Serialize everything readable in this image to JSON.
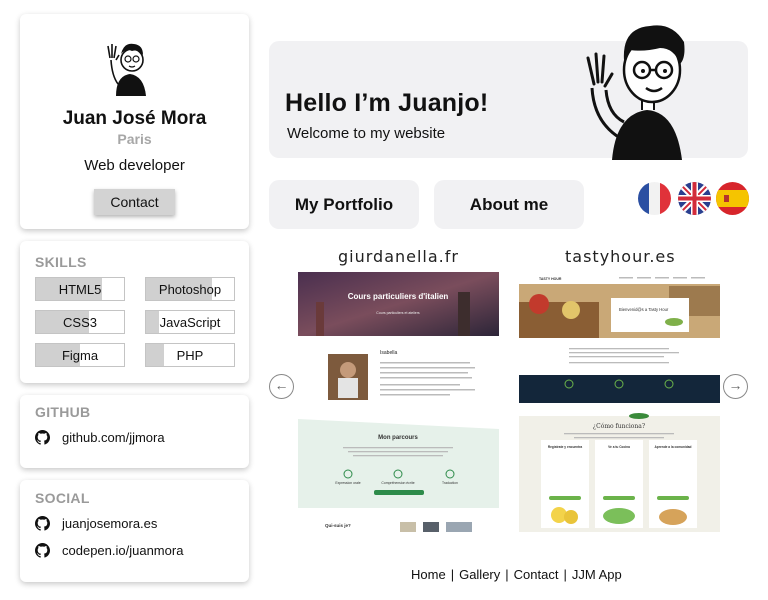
{
  "profile": {
    "name": "Juan José Mora",
    "city": "Paris",
    "role": "Web developer",
    "contact_label": "Contact"
  },
  "skills": {
    "title": "SKILLS",
    "items": [
      {
        "label": "HTML5",
        "level": 0.75
      },
      {
        "label": "Photoshop",
        "level": 0.75
      },
      {
        "label": "CSS3",
        "level": 0.6
      },
      {
        "label": "JavaScript",
        "level": 0.15
      },
      {
        "label": "Figma",
        "level": 0.5
      },
      {
        "label": "PHP",
        "level": 0.2
      }
    ]
  },
  "github": {
    "title": "GITHUB",
    "links": [
      {
        "label": "github.com/jjmora",
        "icon": "github-icon"
      }
    ]
  },
  "social": {
    "title": "SOCIAL",
    "links": [
      {
        "label": "juanjosemora.es",
        "icon": "github-icon"
      },
      {
        "label": "codepen.io/juanmora",
        "icon": "github-icon"
      }
    ]
  },
  "hero": {
    "title": "Hello I’m Juanjo!",
    "subtitle": "Welcome to my website"
  },
  "nav": {
    "portfolio_label": "My Portfolio",
    "about_label": "About me"
  },
  "languages": [
    {
      "name": "fr-flag-icon"
    },
    {
      "name": "uk-flag-icon"
    },
    {
      "name": "es-flag-icon"
    }
  ],
  "gallery": {
    "sites": [
      {
        "title": "giurdanella.fr",
        "hero_text": "Cours particuliers d'italien",
        "hero_sub": "Cours particuliers et ateliers",
        "section_name": "Isabella",
        "section2": "Mon parcours",
        "labels": [
          "Expression orale",
          "Compréhension écrite",
          "Traduction"
        ],
        "footer_heading": "Qui-suis je?"
      },
      {
        "title": "tastyhour.es",
        "brand": "TASTY HOUR",
        "banner_text": "Bienvenid@s a Tasty Hour",
        "section2": "¿Cómo funciona?",
        "columns": [
          "Regístrate y encuentra",
          "Ve a tu Cocina",
          "Aprende a la comunidad"
        ]
      }
    ],
    "prev_icon": "arrow-left-icon",
    "next_icon": "arrow-right-icon"
  },
  "footer": {
    "links": [
      "Home",
      "Gallery",
      "Contact",
      "JJM App"
    ]
  },
  "colors": {
    "card_bg": "#ffffff",
    "hero_bg": "#f1f1f3",
    "muted_text": "#9a9a9a",
    "button_bg": "#d3d3d3"
  }
}
